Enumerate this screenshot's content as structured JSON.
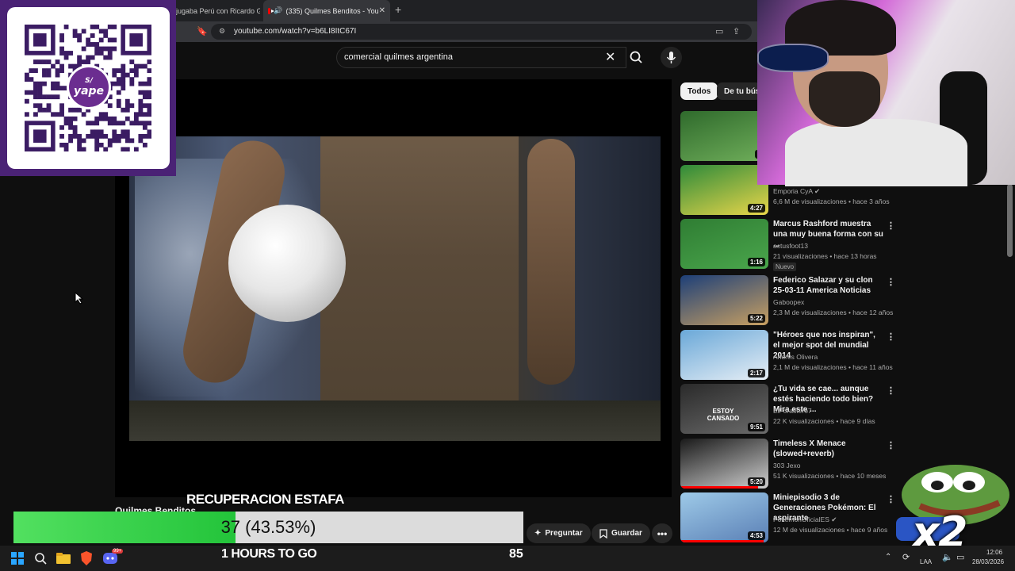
{
  "browser": {
    "tabs": [
      {
        "label": "jugaba Perú con Ricardo Ga"
      },
      {
        "label": "(335) Quilmes Benditos - You"
      }
    ],
    "new_tab_symbol": "+",
    "url": "youtube.com/watch?v=b6LI8ItC67I"
  },
  "youtube": {
    "search_query": "comercial quilmes argentina",
    "video_title": "Quilmes Benditos",
    "filter_chips": [
      {
        "label": "Todos",
        "active": true
      },
      {
        "label": "De tu búsq",
        "active": false
      }
    ],
    "actions": {
      "ask_label": "Preguntar",
      "save_label": "Guardar",
      "more_label": "•••"
    },
    "related": [
      {
        "title": "",
        "channel": "",
        "meta": "",
        "duration": "1:",
        "thumb_colors": [
          "#2f6a2c",
          "#6fae5a"
        ]
      },
      {
        "title": "",
        "channel": "Emporia CyA",
        "verified": true,
        "meta": "6,6 M de visualizaciones • hace 3 años",
        "duration": "4:27",
        "thumb_colors": [
          "#2e8a3a",
          "#e9d64a"
        ]
      },
      {
        "title": "Marcus Rashford muestra una muy buena forma con su ...",
        "channel": "actusfoot13",
        "meta": "21 visualizaciones • hace 13 horas",
        "badge": "Nuevo",
        "duration": "1:16",
        "thumb_colors": [
          "#2f7d33",
          "#4aa64c"
        ]
      },
      {
        "title": "Federico Salazar y su clon 25-03-11 America Noticias",
        "channel": "Gaboopex",
        "meta": "2,3 M de visualizaciones • hace 12 años",
        "duration": "5:22",
        "thumb_colors": [
          "#1d3f78",
          "#c8a062"
        ]
      },
      {
        "title": "\"Héroes que nos inspiran\", el mejor spot del mundial 2014",
        "channel": "Andrés Olivera",
        "meta": "2,1 M de visualizaciones • hace 11 años",
        "duration": "2:17",
        "thumb_colors": [
          "#6aa8d8",
          "#e6eef5"
        ]
      },
      {
        "title": "¿Tu vida se cae... aunque estés haciendo todo bien? Mira este ...",
        "channel": "ElForastero7",
        "meta": "22 K visualizaciones • hace 9 días",
        "duration": "9:51",
        "thumb_text": "ESTOY CANSADO",
        "thumb_colors": [
          "#2a2a2a",
          "#6b6b6b"
        ]
      },
      {
        "title": "Timeless X Menace (slowed+reverb)",
        "channel": "303 Jexo",
        "meta": "51 K visualizaciones • hace 10 meses",
        "duration": "5:20",
        "progress": 0.88,
        "thumb_colors": [
          "#1a1a1a",
          "#cfcfcf"
        ]
      },
      {
        "title": "Miniepisodio 3 de Generaciones Pokémon: El aspirante",
        "channel": "PokemonOficialES",
        "verified": true,
        "meta": "12 M de visualizaciones • hace 9 años",
        "duration": "4:53",
        "progress": 0.95,
        "thumb_colors": [
          "#9ecae8",
          "#5a7fb5"
        ]
      }
    ]
  },
  "overlay": {
    "qr_brand": "yape",
    "qr_currency": "S/",
    "goal_label": "RECUPERACION ESTAFA",
    "goal_value": "37 (43.53%)",
    "goal_fraction": 0.4353,
    "goal_time": "1 HOURS TO GO",
    "goal_target": "85",
    "multiplier": "x2"
  },
  "taskbar": {
    "icons": [
      "windows-icon",
      "search-icon",
      "file-explorer-icon",
      "brave-browser-icon",
      "discord-icon"
    ],
    "discord_badge": "99+",
    "language": "LAA",
    "time": "12:06",
    "date": "28/03/2026"
  },
  "colors": {
    "youtube_bg": "#0f0f0f",
    "youtube_red": "#ff0000",
    "goal_green": "#23c43a",
    "qr_purple": "#4a2275"
  }
}
